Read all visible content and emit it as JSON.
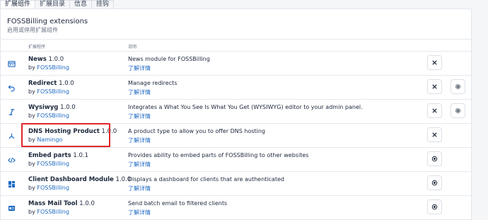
{
  "tabs": [
    "扩展组件",
    "扩展目录",
    "信息",
    "挂钩"
  ],
  "card": {
    "title": "FOSSBilling extensions",
    "subtitle": "启用或停用扩展组件"
  },
  "table": {
    "headers": [
      "扩展程序",
      "说明"
    ],
    "rows": [
      {
        "name": "News",
        "version": "1.0.0",
        "by": "by",
        "author": "FOSSBilling",
        "description": "News module for FOSSBilling",
        "more": "了解详情",
        "icon": "news-icon",
        "action": "uninstall",
        "settings": false
      },
      {
        "name": "Redirect",
        "version": "1.0.0",
        "by": "by",
        "author": "FOSSBilling",
        "description": "Manage redirects",
        "more": "了解详情",
        "icon": "redirect-icon",
        "action": "uninstall",
        "settings": true
      },
      {
        "name": "Wysiwyg",
        "version": "1.0.0",
        "by": "by",
        "author": "FOSSBilling",
        "description": "Integrates a What You See Is What You Get (WYSIWYG) editor to your admin panel.",
        "more": "了解详情",
        "icon": "italic-icon",
        "action": "uninstall",
        "settings": true
      },
      {
        "name": "DNS Hosting Product",
        "version": "1.0.0",
        "by": "by",
        "author": "Namingo",
        "description": "A product type to allow you to offer DNS hosting",
        "more": "了解详情",
        "icon": "network-icon",
        "action": "uninstall",
        "settings": false
      },
      {
        "name": "Embed parts",
        "version": "1.0.1",
        "by": "by",
        "author": "FOSSBilling",
        "description": "Provides ability to embed parts of FOSSBilling to other websites",
        "more": "了解详情",
        "icon": "code-icon",
        "action": "activate",
        "settings": false
      },
      {
        "name": "Client Dashboard Module",
        "version": "1.0.0",
        "by": "by",
        "author": "FOSSBilling",
        "description": "Displays a dashboard for clients that are authenticated",
        "more": "了解详情",
        "icon": "dashboard-icon",
        "action": "activate",
        "settings": false
      },
      {
        "name": "Mass Mail Tool",
        "version": "1.0.0",
        "by": "by",
        "author": "FOSSBilling",
        "description": "Send batch email to filtered clients",
        "more": "了解详情",
        "icon": "mail-icon",
        "action": "activate",
        "settings": false
      }
    ]
  },
  "colors": {
    "link": "#206bc4",
    "highlight": "#e0282b"
  }
}
